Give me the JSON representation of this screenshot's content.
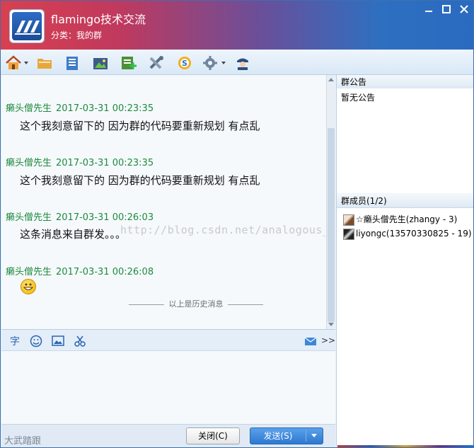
{
  "window": {
    "group_name": "flamingo技术交流",
    "category": "分类：我的群",
    "controls": [
      "minimize",
      "maximize",
      "close"
    ]
  },
  "toolbar": {
    "icons": [
      "home-icon",
      "folder-icon",
      "note-icon",
      "album-icon",
      "add-app-icon",
      "tools-icon",
      "sync-icon",
      "settings-icon",
      "admin-icon"
    ]
  },
  "chat": {
    "messages": [
      {
        "sender": "癞头僧先生",
        "time": "2017-03-31 00:23:35",
        "text": "这个我刻意留下的 因为群的代码要重新规划 有点乱"
      },
      {
        "sender": "癞头僧先生",
        "time": "2017-03-31 00:23:35",
        "text": "这个我刻意留下的 因为群的代码要重新规划 有点乱"
      },
      {
        "sender": "癞头僧先生",
        "time": "2017-03-31 00:26:03",
        "text": "这条消息来自群发。。。"
      },
      {
        "sender": "癞头僧先生",
        "time": "2017-03-31 00:26:08",
        "text": ""
      }
    ],
    "watermark": "http://blog.csdn.net/analogous_",
    "history_divider": "以上是历史消息"
  },
  "input_toolbar": {
    "font_label": "字",
    "icons": [
      "font-icon",
      "emoji-icon",
      "image-icon",
      "screenshot-icon",
      "mail-icon"
    ],
    "expand_label": ">>"
  },
  "bottom": {
    "brand": "大武踏跟",
    "close_label": "关闭(C)",
    "send_label": "发送(S)"
  },
  "right_panel": {
    "announcement_title": "群公告",
    "announcement_text": "暂无公告",
    "members_title": "群成员(1/2)",
    "members": [
      {
        "label": "☆癞头僧先生(zhangy - 3)"
      },
      {
        "label": "liyongc(13570330825 - 19)"
      }
    ]
  },
  "colors": {
    "sender_green": "#1f8a3f",
    "send_button": "#2d78d1",
    "title_gradient_left": "#d8404f",
    "title_gradient_right": "#2a6bc0"
  }
}
